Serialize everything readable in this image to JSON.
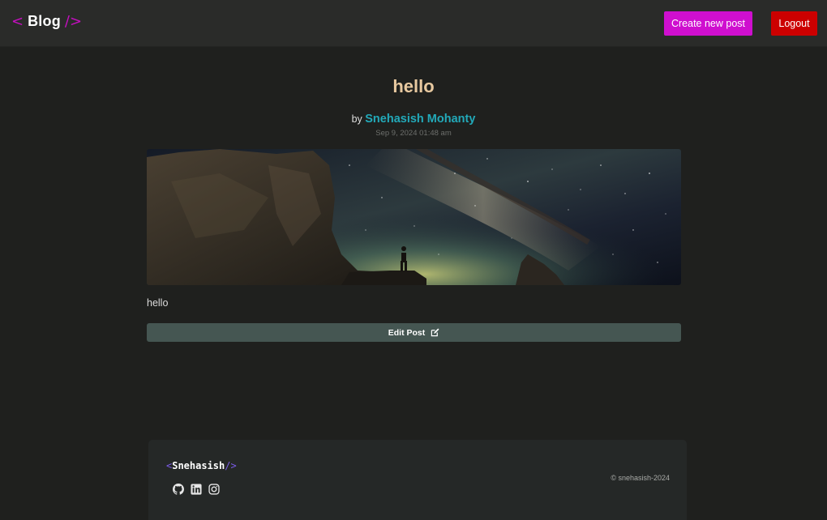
{
  "header": {
    "brand_open": "<",
    "brand_name": "Blog",
    "brand_close": "/>",
    "create_label": "Create new post",
    "logout_label": "Logout"
  },
  "post": {
    "title": "hello",
    "by_label": "by",
    "author": "Snehasish Mohanty",
    "date": "Sep 9, 2024 01:48 am",
    "content": "hello",
    "edit_label": "Edit Post"
  },
  "footer": {
    "brand_open": "<",
    "brand_name": "Snehasish",
    "brand_close": "/>",
    "copyright": "© snehasish-2024",
    "social_icons": [
      "github-icon",
      "linkedin-icon",
      "instagram-icon"
    ]
  },
  "colors": {
    "accent_magenta": "#cf0fcf",
    "logout_red": "#cc0000",
    "title_tan": "#e8c9a0",
    "author_teal": "#22a9b9",
    "edit_button": "#455652"
  }
}
